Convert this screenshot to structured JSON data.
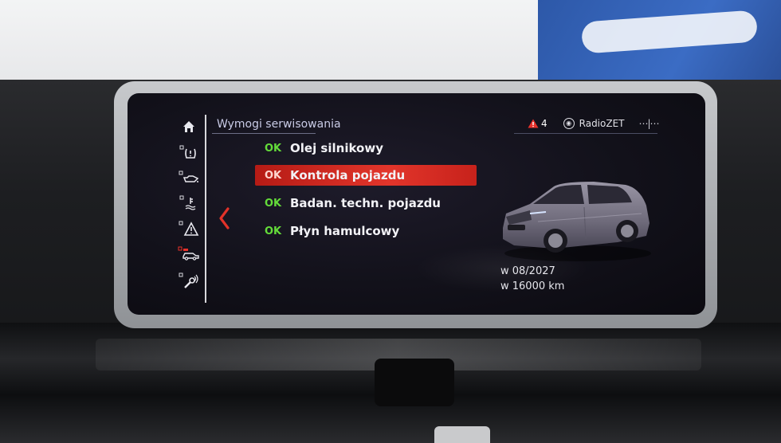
{
  "screen": {
    "title": "Wymogi serwisowania",
    "status": {
      "warning_count": "4",
      "radio_station": "RadioZET",
      "icons": [
        "warning-triangle-icon",
        "radio-icon",
        "phone-link-icon"
      ]
    },
    "nav_icons": [
      "home-icon",
      "tire-pressure-icon",
      "oil-can-icon",
      "coolant-icon",
      "warning-triangle-icon",
      "car-service-icon",
      "wrench-icon"
    ],
    "items": [
      {
        "status": "OK",
        "label": "Olej silnikowy",
        "selected": false
      },
      {
        "status": "OK",
        "label": "Kontrola pojazdu",
        "selected": true
      },
      {
        "status": "OK",
        "label": "Badan. techn. pojazdu",
        "selected": false
      },
      {
        "status": "OK",
        "label": "Płyn hamulcowy",
        "selected": false
      }
    ],
    "due": {
      "date": "w 08/2027",
      "distance": "w 16000 km"
    }
  },
  "colors": {
    "ok": "#64dc3a",
    "selection": "#e2352b",
    "warning": "#e8312a"
  }
}
